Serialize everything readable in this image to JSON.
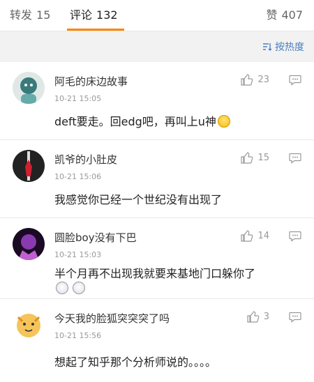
{
  "tabs": [
    {
      "label": "转发",
      "count": "15"
    },
    {
      "label": "评论",
      "count": "132"
    },
    {
      "label": "赞",
      "count": "407"
    }
  ],
  "sort": {
    "label": "按热度",
    "icon": "sort-icon"
  },
  "comments": [
    {
      "user": "阿毛的床边故事",
      "time": "10-21 15:05",
      "likes": "23",
      "text": "deft要走。回edg吧，再叫上u神",
      "emoji": [
        "smile-emoji"
      ],
      "avatar_color": "#3a7a7a"
    },
    {
      "user": "凯爷的小肚皮",
      "time": "10-21 15:06",
      "likes": "15",
      "text": "我感觉你已经一个世纪没有出现了",
      "emoji": [],
      "avatar_color": "#1a1a1a"
    },
    {
      "user": "圆脸boy没有下巴",
      "time": "10-21 15:03",
      "likes": "14",
      "text": "半个月再不出现我就要来基地门口躲你了",
      "emoji": [
        "cry-emoji",
        "cry-emoji"
      ],
      "avatar_color": "#6a2a8a"
    },
    {
      "user": "今天我的脸狐突突突了吗",
      "time": "10-21 15:56",
      "likes": "3",
      "text": "想起了知乎那个分析师说的。。。。",
      "emoji": [],
      "avatar_color": "#f0c050"
    }
  ],
  "colors": {
    "accent": "#ff8200",
    "link": "#4a7fbf"
  }
}
